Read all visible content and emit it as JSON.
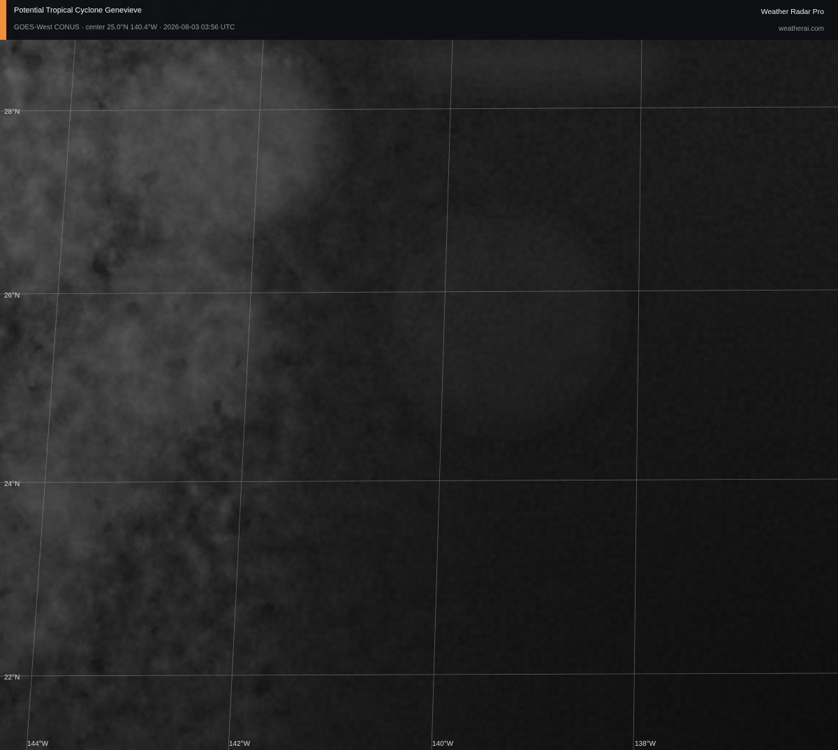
{
  "header": {
    "title": "Potential Tropical Cyclone Genevieve",
    "subtitle": "GOES-West CONUS · center 25.0°N 140.4°W · 2026-08-03 03:56 UTC",
    "brand": "Weather Radar Pro",
    "site": "weatherai.com",
    "accent_color": "#f0913a"
  },
  "map": {
    "imagery": "satellite-visible-grayscale",
    "latitude_labels": [
      "28°N",
      "26°N",
      "24°N",
      "22°N"
    ],
    "longitude_labels": [
      "144°W",
      "142°W",
      "140°W",
      "138°W"
    ],
    "gridline_color": "#9a9a9a",
    "label_color": "#d9d9d9"
  }
}
